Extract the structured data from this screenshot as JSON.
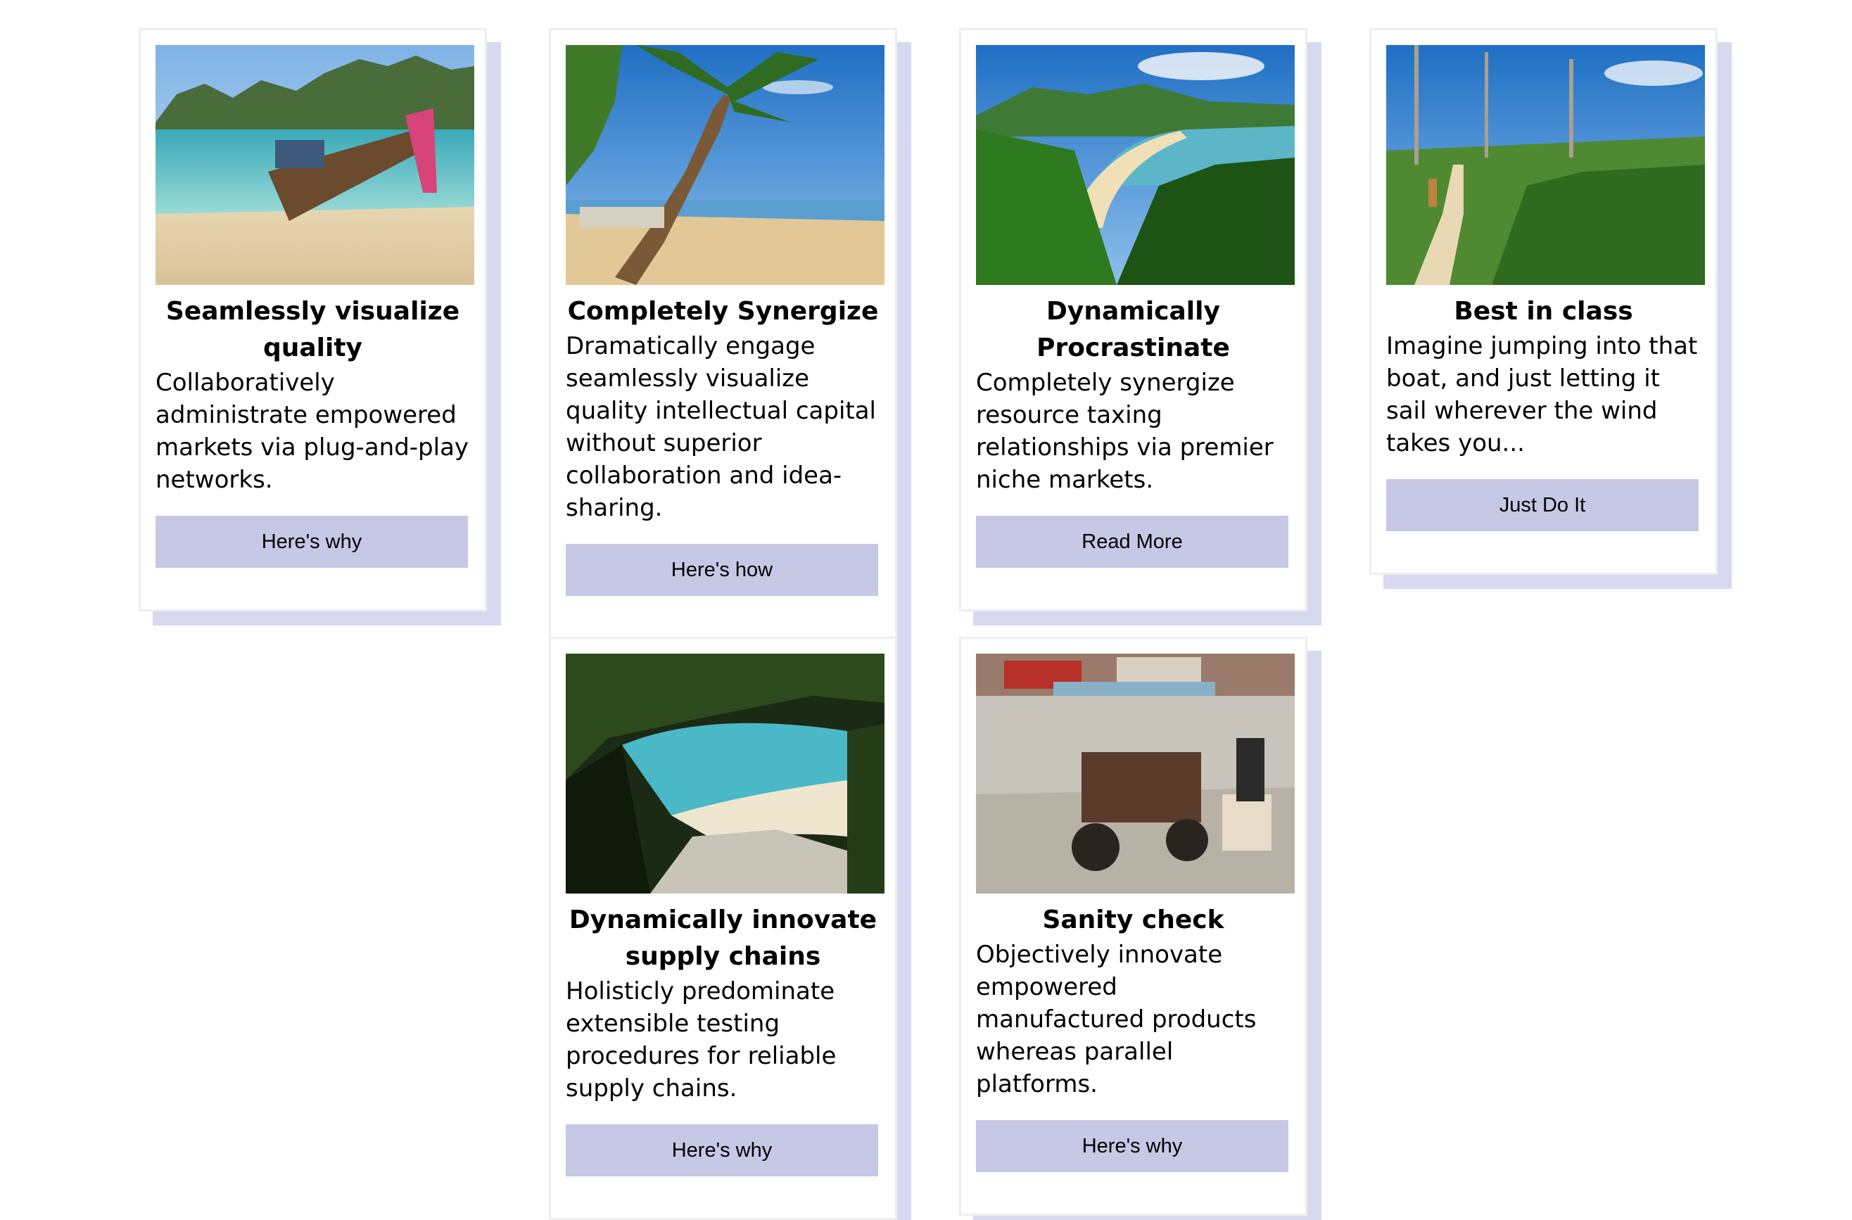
{
  "cards": [
    {
      "image_alt": "longtail boat moored on a tropical beach with limestone cliffs",
      "title": "Seamlessly visualize quality",
      "text": "Collaboratively administrate empowered markets via plug-and-play networks.",
      "button": "Here's why"
    },
    {
      "image_alt": "palm trees leaning over a sandy beach",
      "title": "Completely Synergize",
      "text": "Dramatically engage seamlessly visualize quality intellectual capital without superior collaboration and idea-sharing.",
      "button": "Here's how"
    },
    {
      "image_alt": "curved beach seen through green ferns",
      "title": "Dynamically Procrastinate",
      "text": "Completely synergize resource taxing relationships via premier niche markets.",
      "button": "Read More"
    },
    {
      "image_alt": "hiker walking a sandy trail through bush",
      "title": "Best in class",
      "text": "Imagine jumping into that boat, and just letting it sail wherever the wind takes you...",
      "button": "Just Do It"
    },
    {
      "image_alt": "turquoise cove with rocks framed by trees",
      "title": "Dynamically innovate supply chains",
      "text": "Holisticly predominate extensible testing procedures for reliable supply chains.",
      "button": "Here's why"
    },
    {
      "image_alt": "tuk-tuk on a busy market street",
      "title": "Sanity check",
      "text": "Objectively innovate empowered manufactured products whereas parallel platforms.",
      "button": "Here's why"
    }
  ]
}
